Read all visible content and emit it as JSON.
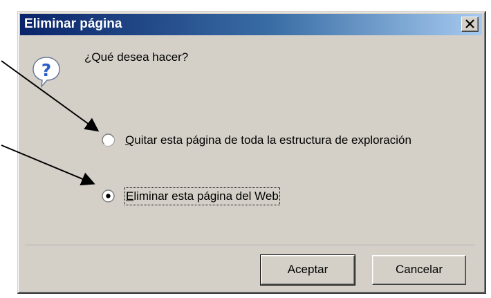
{
  "dialog": {
    "title": "Eliminar página",
    "question": "¿Qué desea hacer?",
    "options": [
      {
        "label_accesskey": "Q",
        "label_rest": "uitar esta página de toda la estructura de exploración",
        "selected": false
      },
      {
        "label_accesskey": "E",
        "label_rest": "liminar esta página del Web",
        "selected": true
      }
    ],
    "buttons": {
      "ok": "Aceptar",
      "cancel": "Cancelar"
    }
  },
  "icons": {
    "title_close": "close-icon",
    "question": "question-icon",
    "annotation_arrow": "arrow-icon"
  },
  "colors": {
    "titlebar_start": "#0a246a",
    "titlebar_end": "#a6caf0",
    "dialog_bg": "#d4d0c8",
    "question_icon": "#2a5fc7"
  }
}
